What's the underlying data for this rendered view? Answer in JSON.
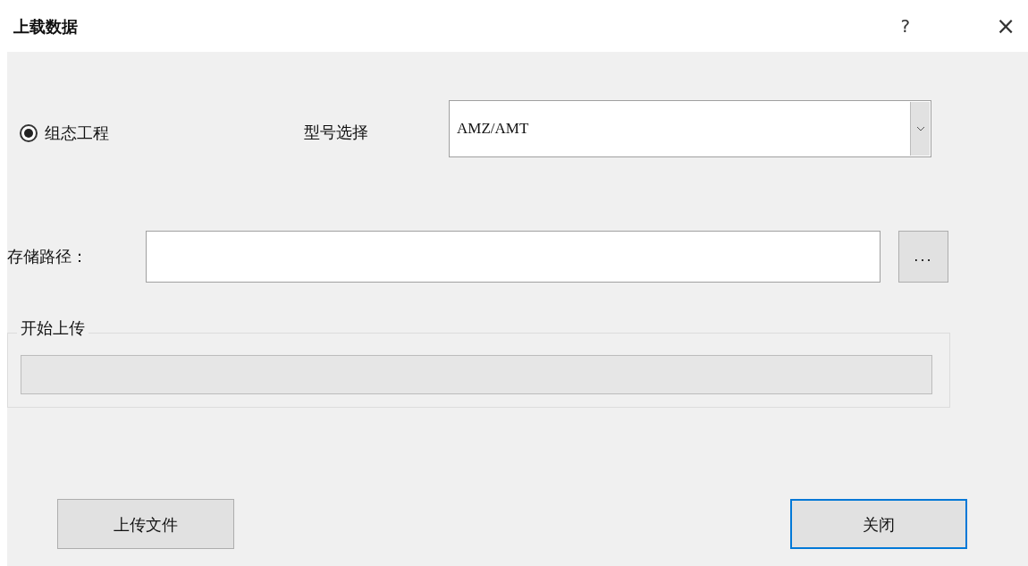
{
  "window": {
    "title": "上载数据",
    "help": "?",
    "close": "×"
  },
  "mode_option": {
    "label": "组态工程",
    "selected": true
  },
  "model": {
    "label": "型号选择",
    "value": "AMZ/AMT"
  },
  "path": {
    "label": "存储路径：",
    "browse": "..."
  },
  "upload_group": {
    "title": "开始上传",
    "level": 0
  },
  "buttons": [
    {
      "label": "上传文件",
      "focused": false
    },
    {
      "label": "关闭",
      "focused": true
    }
  ]
}
